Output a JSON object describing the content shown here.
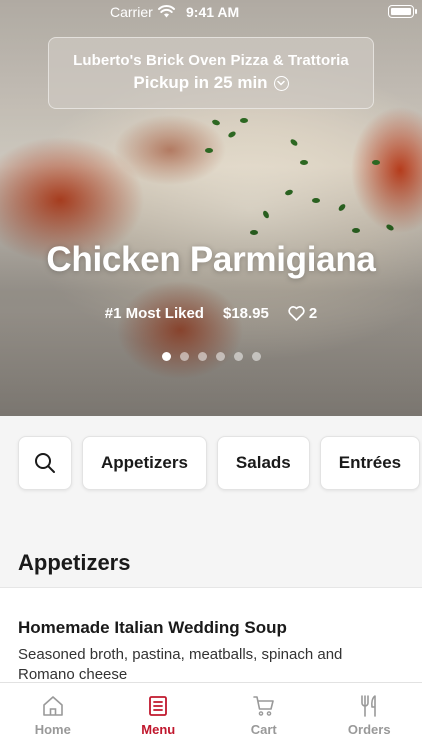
{
  "status_bar": {
    "carrier": "Carrier",
    "time": "9:41 AM"
  },
  "restaurant": {
    "name": "Luberto's Brick Oven Pizza & Trattoria",
    "pickup": "Pickup in 25 min"
  },
  "featured": {
    "title": "Chicken Parmigiana",
    "badge": "#1 Most Liked",
    "price": "$18.95",
    "likes": "2",
    "carousel": {
      "total": 6,
      "active": 1
    }
  },
  "categories": [
    "Appetizers",
    "Salads",
    "Entrées"
  ],
  "section": {
    "title": "Appetizers",
    "items": [
      {
        "name": "Homemade Italian Wedding Soup",
        "description": "Seasoned broth, pastina, meatballs, spinach and Romano cheese"
      }
    ]
  },
  "tabs": [
    {
      "label": "Home",
      "icon": "home-icon",
      "active": false
    },
    {
      "label": "Menu",
      "icon": "menu-icon",
      "active": true
    },
    {
      "label": "Cart",
      "icon": "cart-icon",
      "active": false
    },
    {
      "label": "Orders",
      "icon": "fork-knife-icon",
      "active": false
    }
  ],
  "colors": {
    "accent": "#c0172d",
    "inactive_tab": "#999999"
  }
}
